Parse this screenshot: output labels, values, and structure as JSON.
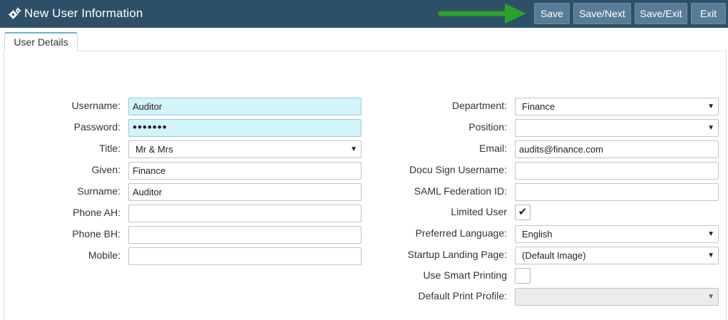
{
  "header": {
    "title": "New User Information",
    "icon": "gears-icon",
    "buttons": {
      "save": "Save",
      "save_next": "Save/Next",
      "save_exit": "Save/Exit",
      "exit": "Exit"
    },
    "colors": {
      "bar": "#2e4f68",
      "button": "#587c96",
      "arrow": "#2aa12a"
    }
  },
  "tabs": [
    {
      "label": "User Details",
      "active": true
    }
  ],
  "left_form": {
    "username": {
      "label": "Username:",
      "value": "Auditor"
    },
    "password": {
      "label": "Password:",
      "value": "•••••••"
    },
    "title": {
      "label": "Title:",
      "value": "Mr & Mrs"
    },
    "given": {
      "label": "Given:",
      "value": "Finance"
    },
    "surname": {
      "label": "Surname:",
      "value": "Auditor"
    },
    "phone_ah": {
      "label": "Phone AH:",
      "value": ""
    },
    "phone_bh": {
      "label": "Phone BH:",
      "value": ""
    },
    "mobile": {
      "label": "Mobile:",
      "value": ""
    }
  },
  "right_form": {
    "department": {
      "label": "Department:",
      "value": "Finance"
    },
    "position": {
      "label": "Position:",
      "value": ""
    },
    "email": {
      "label": "Email:",
      "value": "audits@finance.com"
    },
    "docu_sign": {
      "label": "Docu Sign Username:",
      "value": ""
    },
    "saml": {
      "label": "SAML Federation ID:",
      "value": ""
    },
    "limited_user": {
      "label": "Limited User",
      "checked": true,
      "mark": "✔"
    },
    "preferred_language": {
      "label": "Preferred Language:",
      "value": "English"
    },
    "startup_landing": {
      "label": "Startup Landing Page:",
      "value": "(Default Image)"
    },
    "smart_printing": {
      "label": "Use Smart Printing",
      "checked": false
    },
    "print_profile": {
      "label": "Default Print Profile:",
      "value": ""
    }
  },
  "caret": "▼"
}
